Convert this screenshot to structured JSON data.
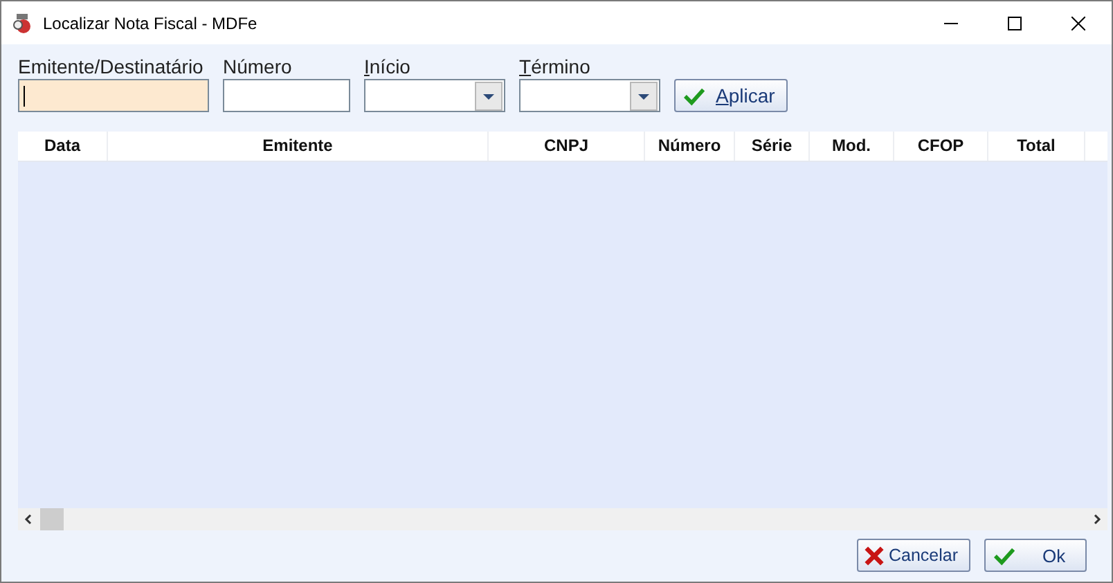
{
  "window": {
    "title": "Localizar Nota Fiscal - MDFe"
  },
  "filters": [
    {
      "kind": "text",
      "label": "Emitente/Destinatário",
      "accesskey_underlined": false,
      "focused": true
    },
    {
      "kind": "text",
      "label": "Número",
      "accesskey_underlined": false,
      "focused": false
    },
    {
      "kind": "combo",
      "label": "Início",
      "accesskey_underlined": true,
      "focused": false
    },
    {
      "kind": "combo",
      "label": "Término",
      "accesskey_underlined": true,
      "focused": false
    }
  ],
  "apply_button": {
    "label": "Aplicar",
    "accesskey_underlined": true
  },
  "table": {
    "columns": [
      "Data",
      "Emitente",
      "CNPJ",
      "Número",
      "Série",
      "Mod.",
      "CFOP",
      "Total"
    ]
  },
  "buttons": [
    {
      "kind": "cancel",
      "label": "Cancelar"
    },
    {
      "kind": "ok",
      "label": "Ok"
    }
  ]
}
